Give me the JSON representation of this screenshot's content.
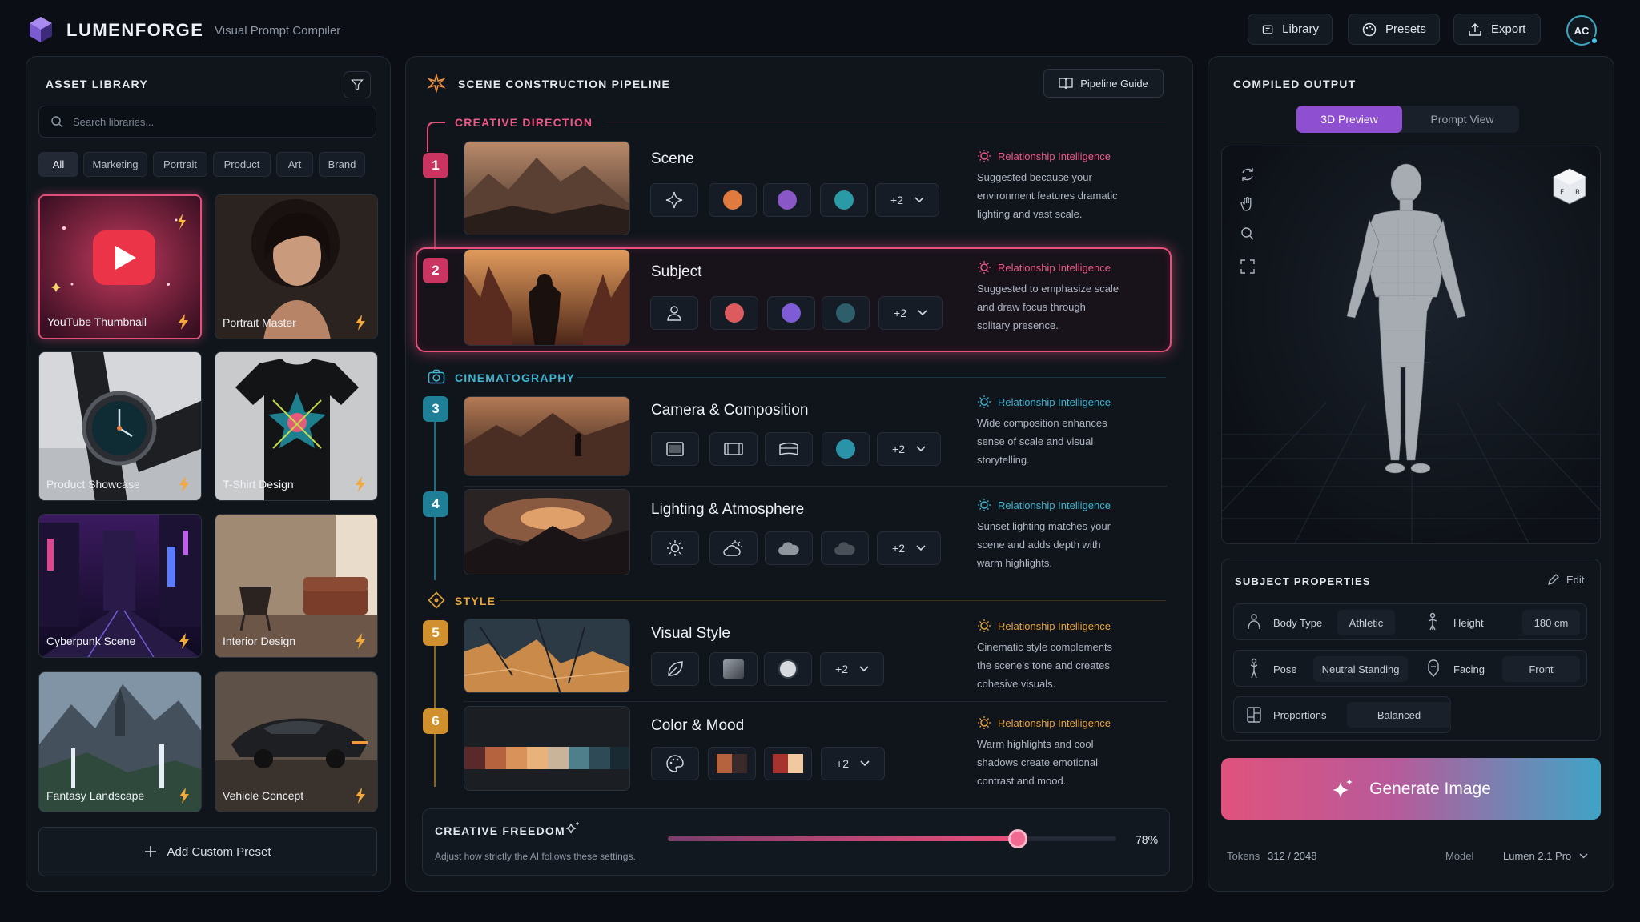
{
  "header": {
    "brand": "LUMENFORGE",
    "subtitle": "Visual Prompt Compiler",
    "buttons": {
      "library": "Library",
      "presets": "Presets",
      "export": "Export"
    },
    "avatar": "AC"
  },
  "asset_library": {
    "title": "ASSET LIBRARY",
    "search_placeholder": "Search libraries...",
    "filters": [
      "All",
      "Marketing",
      "Portrait",
      "Product",
      "Art",
      "Brand"
    ],
    "active_filter": "All",
    "presets": [
      "YouTube Thumbnail",
      "Portrait Master",
      "Product Showcase",
      "T-Shirt Design",
      "Cyberpunk Scene",
      "Interior Design",
      "Fantasy Landscape",
      "Vehicle Concept"
    ],
    "selected_preset": "YouTube Thumbnail",
    "add_label": "Add Custom Preset"
  },
  "pipeline": {
    "title": "SCENE CONSTRUCTION PIPELINE",
    "guide_label": "Pipeline Guide",
    "sections": {
      "creative": "CREATIVE DIRECTION",
      "cinema": "CINEMATOGRAPHY",
      "style": "STYLE"
    },
    "ri_label": "Relationship Intelligence",
    "more_label": "+2",
    "steps": [
      {
        "num": "1",
        "title": "Scene",
        "lines": [
          "Suggested because your",
          "environment features dramatic",
          "lighting and vast scale."
        ]
      },
      {
        "num": "2",
        "title": "Subject",
        "lines": [
          "Suggested to emphasize scale",
          "and draw focus through",
          "solitary presence."
        ]
      },
      {
        "num": "3",
        "title": "Camera & Composition",
        "lines": [
          "Wide composition enhances",
          "sense of scale and visual",
          "storytelling."
        ]
      },
      {
        "num": "4",
        "title": "Lighting & Atmosphere",
        "lines": [
          "Sunset lighting matches your",
          "scene and adds depth with",
          "warm highlights."
        ]
      },
      {
        "num": "5",
        "title": "Visual Style",
        "lines": [
          "Cinematic style complements",
          "the scene's tone and creates",
          "cohesive visuals."
        ]
      },
      {
        "num": "6",
        "title": "Color & Mood",
        "lines": [
          "Warm highlights and cool",
          "shadows create emotional",
          "contrast and mood."
        ]
      }
    ],
    "selected_step": "2",
    "freedom": {
      "title": "CREATIVE FREEDOM",
      "hint": "Adjust how strictly the AI follows these settings.",
      "value": 0.78,
      "value_label": "78%"
    }
  },
  "compiled": {
    "title": "COMPILED OUTPUT",
    "tabs": [
      "3D Preview",
      "Prompt View"
    ],
    "active_tab": "3D Preview",
    "cube_faces": [
      "F",
      "R"
    ],
    "properties": {
      "title": "SUBJECT PROPERTIES",
      "edit": "Edit",
      "body_type_label": "Body Type",
      "body_type": "Athletic",
      "height_label": "Height",
      "height": "180 cm",
      "pose_label": "Pose",
      "pose": "Neutral Standing",
      "facing_label": "Facing",
      "facing": "Front",
      "proportions_label": "Proportions",
      "proportions": "Balanced"
    },
    "generate_label": "Generate Image",
    "tokens_label": "Tokens",
    "tokens": "312 / 2048",
    "model_label": "Model",
    "model": "Lumen 2.1 Pro"
  },
  "colors": {
    "accent_pink": "#e9507c",
    "accent_teal": "#3fa4c6",
    "accent_gold": "#e0a03a",
    "background": "#0b0f15"
  }
}
